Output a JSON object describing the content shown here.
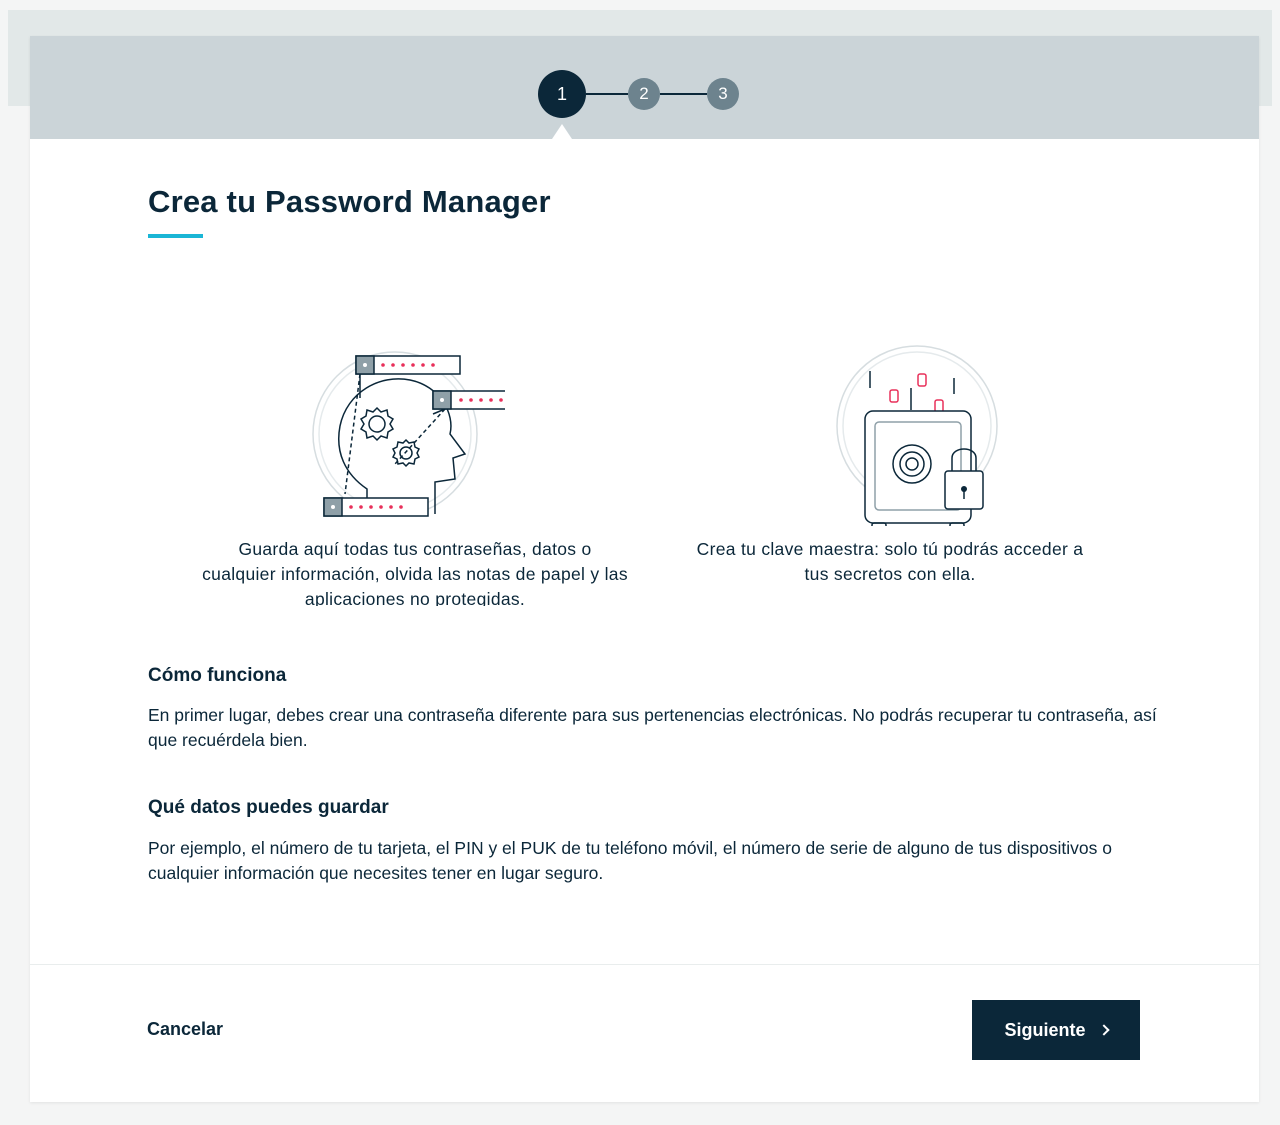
{
  "stepper": {
    "steps": [
      "1",
      "2",
      "3"
    ],
    "current": 1
  },
  "title": "Crea tu Password Manager",
  "features": [
    {
      "icon": "head-gears-passwords-icon",
      "text": "Guarda aquí todas tus contraseñas, datos o cualquier información, olvida las notas de papel y las aplicaciones no protegidas."
    },
    {
      "icon": "safe-padlock-icon",
      "text": "Crea tu clave maestra: solo tú podrás acceder a tus secretos con ella."
    }
  ],
  "sections": {
    "how": {
      "title": "Cómo funciona",
      "body": "En primer lugar, debes crear una contraseña diferente para sus pertenencias electrónicas. No podrás recuperar tu contraseña, así que recuérdela bien."
    },
    "what": {
      "title": "Qué datos puedes guardar",
      "body": "Por ejemplo, el número de tu tarjeta, el PIN y el PUK de tu teléfono móvil, el número de serie de alguno de tus dispositivos o cualquier información que necesites tener en lugar seguro."
    }
  },
  "footer": {
    "cancel_label": "Cancelar",
    "next_label": "Siguiente"
  },
  "colors": {
    "primary": "#0b2739",
    "accent": "#1ab6d6",
    "step_inactive": "#6d838e",
    "highlight": "#e8305a"
  }
}
